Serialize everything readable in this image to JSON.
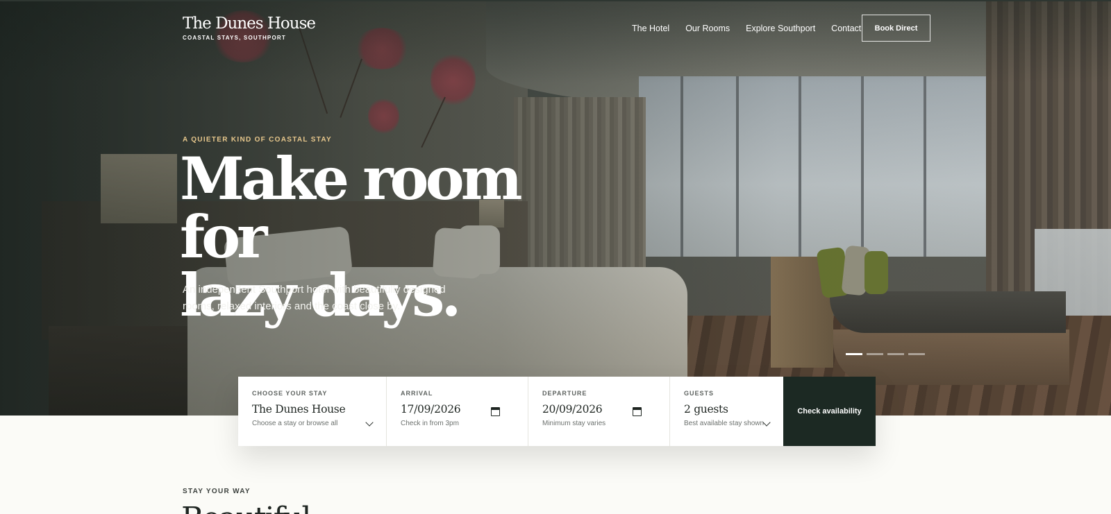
{
  "header": {
    "logo_title": "The Dunes House",
    "logo_subtitle": "COASTAL STAYS, SOUTHPORT",
    "nav": [
      "The Hotel",
      "Our Rooms",
      "Explore Southport",
      "Contact"
    ],
    "book_label": "Book Direct"
  },
  "hero": {
    "eyebrow": "A QUIETER KIND OF COASTAL STAY",
    "headline_line1": "Make room for",
    "headline_line2": "lazy days.",
    "subtext": "An independent Southport hotel with beautifully designed rooms, relaxed interiors and the coast close by.",
    "slides_total": 4,
    "slide_active": 1
  },
  "booking": {
    "stay": {
      "label": "CHOOSE YOUR STAY",
      "value": "The Dunes House",
      "hint": "Choose a stay or browse all"
    },
    "arrival": {
      "label": "ARRIVAL",
      "value": "17/09/2026",
      "hint": "Check in from 3pm"
    },
    "departure": {
      "label": "DEPARTURE",
      "value": "20/09/2026",
      "hint": "Minimum stay varies"
    },
    "guests": {
      "label": "GUESTS",
      "value": "2 guests",
      "hint": "Best available stay shown"
    },
    "submit_label": "Check availability"
  },
  "section": {
    "eyebrow": "STAY YOUR WAY",
    "title": "Beautiful"
  },
  "colors": {
    "accent_gold": "#e7c78c",
    "dark_green": "#1c2923",
    "page_bg": "#fbfbf7"
  },
  "icons": {
    "calendar": "calendar-icon",
    "chevron": "chevron-down-icon"
  }
}
